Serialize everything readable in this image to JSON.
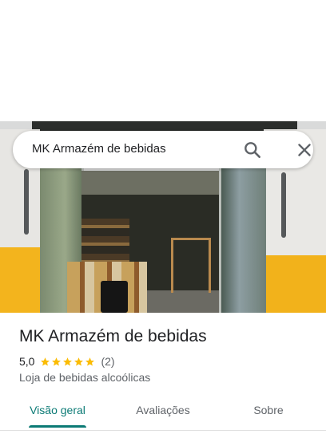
{
  "search": {
    "query": "MK Armazém de bebidas",
    "search_icon": "search-icon",
    "close_icon": "close-icon"
  },
  "place": {
    "name": "MK Armazém de bebidas",
    "rating": "5,0",
    "rating_fraction": 1.0,
    "star_count": 5,
    "review_count": "(2)",
    "category": "Loja de bebidas alcoólicas"
  },
  "tabs": [
    {
      "label": "Visão geral",
      "active": true
    },
    {
      "label": "Avaliações",
      "active": false
    },
    {
      "label": "Sobre",
      "active": false
    }
  ],
  "colors": {
    "accent": "#0b7a75",
    "star": "#fbbc04",
    "text_primary": "#202124",
    "text_secondary": "#5f6368"
  }
}
